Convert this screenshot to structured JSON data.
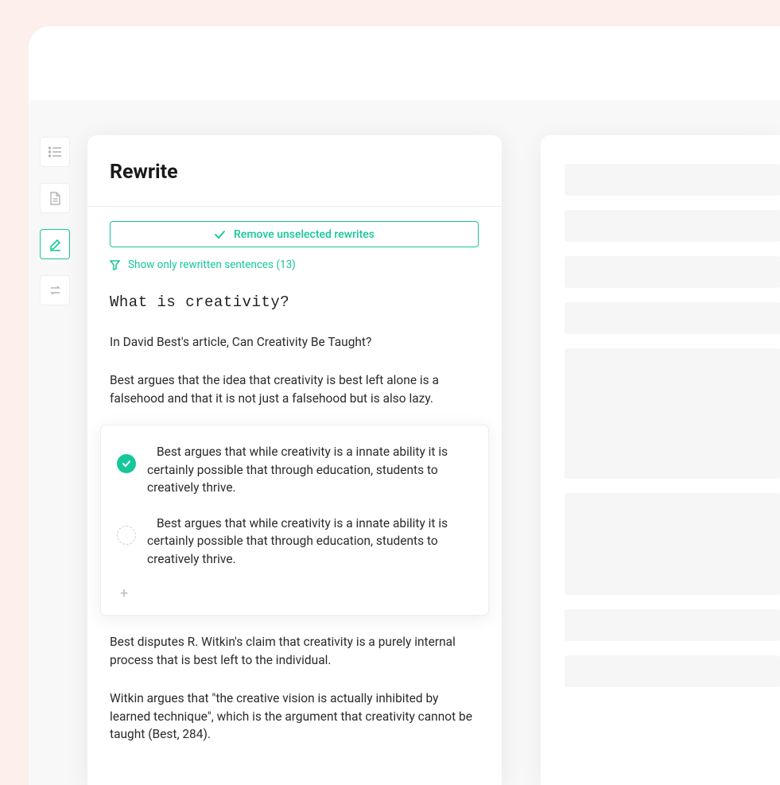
{
  "panel": {
    "title": "Rewrite",
    "remove_btn": "Remove unselected rewrites",
    "show_only": "Show only rewritten sentences (13)"
  },
  "content": {
    "question": "What is creativity?",
    "p1": "In David Best's article, Can Creativity Be Taught?",
    "p2": "Best argues that the idea that creativity is best left alone is a falsehood and that it is not just a falsehood but is also lazy.",
    "options": [
      {
        "text": "Best argues that while creativity is a innate ability it is certainly possible that through education, students to creatively thrive.",
        "selected": true
      },
      {
        "text": "Best argues that while creativity is a innate ability it is certainly possible that through education, students to creatively thrive.",
        "selected": false
      }
    ],
    "add_label": "+",
    "p3": "Best disputes R. Witkin's claim that creativity is a purely internal process that is best left to the individual.",
    "p4": "Witkin argues that \"the creative vision is actually inhibited by learned technique\", which is the argument that creativity cannot be taught (Best, 284)."
  },
  "right_placeholders": [
    {
      "h": 40
    },
    {
      "h": 40
    },
    {
      "h": 40
    },
    {
      "h": 40
    },
    {
      "h": 164
    },
    {
      "h": 128
    },
    {
      "h": 40
    },
    {
      "h": 40
    }
  ]
}
